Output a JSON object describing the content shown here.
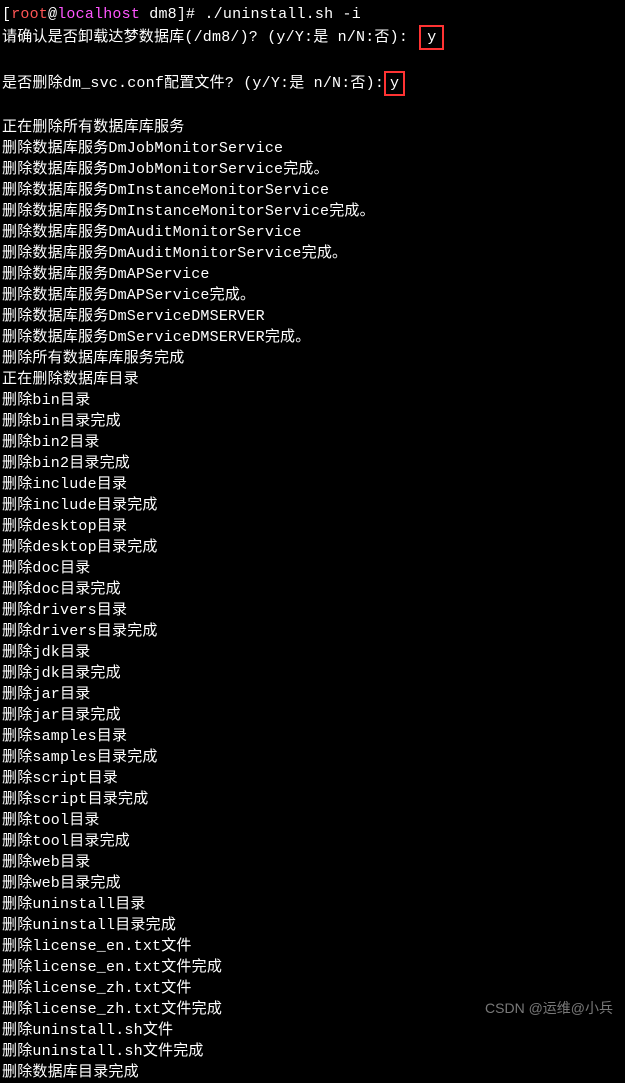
{
  "prompt": {
    "userPrefix": "root",
    "host": "localhost",
    "path": " dm8",
    "command": "./uninstall.sh -i"
  },
  "confirm1": {
    "text": "请确认是否卸载达梦数据库(/dm8/)? (y/Y:是 n/N:否):",
    "answer": "y"
  },
  "confirm2": {
    "text": "是否删除dm_svc.conf配置文件? (y/Y:是 n/N:否):",
    "answer": "y"
  },
  "outputs": [
    "正在删除所有数据库库服务",
    "删除数据库服务DmJobMonitorService",
    "删除数据库服务DmJobMonitorService完成。",
    "删除数据库服务DmInstanceMonitorService",
    "删除数据库服务DmInstanceMonitorService完成。",
    "删除数据库服务DmAuditMonitorService",
    "删除数据库服务DmAuditMonitorService完成。",
    "删除数据库服务DmAPService",
    "删除数据库服务DmAPService完成。",
    "删除数据库服务DmServiceDMSERVER",
    "删除数据库服务DmServiceDMSERVER完成。",
    "删除所有数据库库服务完成",
    "正在删除数据库目录",
    "删除bin目录",
    "删除bin目录完成",
    "删除bin2目录",
    "删除bin2目录完成",
    "删除include目录",
    "删除include目录完成",
    "删除desktop目录",
    "删除desktop目录完成",
    "删除doc目录",
    "删除doc目录完成",
    "删除drivers目录",
    "删除drivers目录完成",
    "删除jdk目录",
    "删除jdk目录完成",
    "删除jar目录",
    "删除jar目录完成",
    "删除samples目录",
    "删除samples目录完成",
    "删除script目录",
    "删除script目录完成",
    "删除tool目录",
    "删除tool目录完成",
    "删除web目录",
    "删除web目录完成",
    "删除uninstall目录",
    "删除uninstall目录完成",
    "删除license_en.txt文件",
    "删除license_en.txt文件完成",
    "删除license_zh.txt文件",
    "删除license_zh.txt文件完成",
    "删除uninstall.sh文件",
    "删除uninstall.sh文件完成",
    "删除数据库目录完成"
  ],
  "watermark": "CSDN @运维@小兵"
}
